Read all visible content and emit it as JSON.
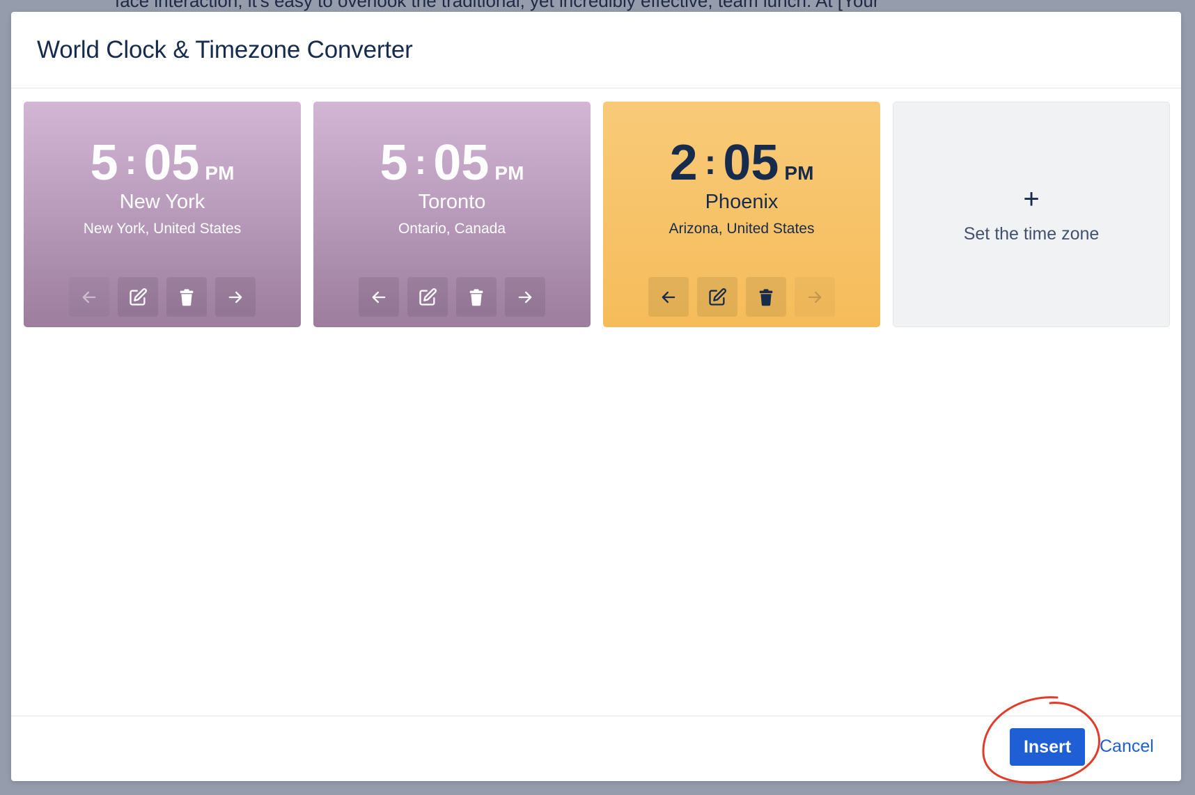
{
  "background": {
    "text": "face interaction, it's easy to overlook the traditional, yet incredibly effective, team lunch. At [Your"
  },
  "modal": {
    "title": "World Clock & Timezone Converter"
  },
  "clocks": [
    {
      "hours": "5",
      "minutes": "05",
      "ampm": "PM",
      "city": "New York",
      "region": "New York, United States",
      "theme": "purple",
      "left_disabled": true,
      "right_disabled": false
    },
    {
      "hours": "5",
      "minutes": "05",
      "ampm": "PM",
      "city": "Toronto",
      "region": "Ontario, Canada",
      "theme": "purple",
      "left_disabled": false,
      "right_disabled": false
    },
    {
      "hours": "2",
      "minutes": "05",
      "ampm": "PM",
      "city": "Phoenix",
      "region": "Arizona, United States",
      "theme": "orange",
      "left_disabled": false,
      "right_disabled": true
    }
  ],
  "add_card": {
    "icon": "+",
    "label": "Set the time zone"
  },
  "footer": {
    "insert_label": "Insert",
    "cancel_label": "Cancel"
  },
  "colors": {
    "primary": "#1f5fd6",
    "purple_top": "#d3b6d6",
    "purple_bottom": "#9c7d9e",
    "orange": "#f7c368",
    "annotation": "#e23b2a"
  },
  "icons": [
    "arrow-left-icon",
    "edit-icon",
    "trash-icon",
    "arrow-right-icon",
    "plus-icon"
  ]
}
